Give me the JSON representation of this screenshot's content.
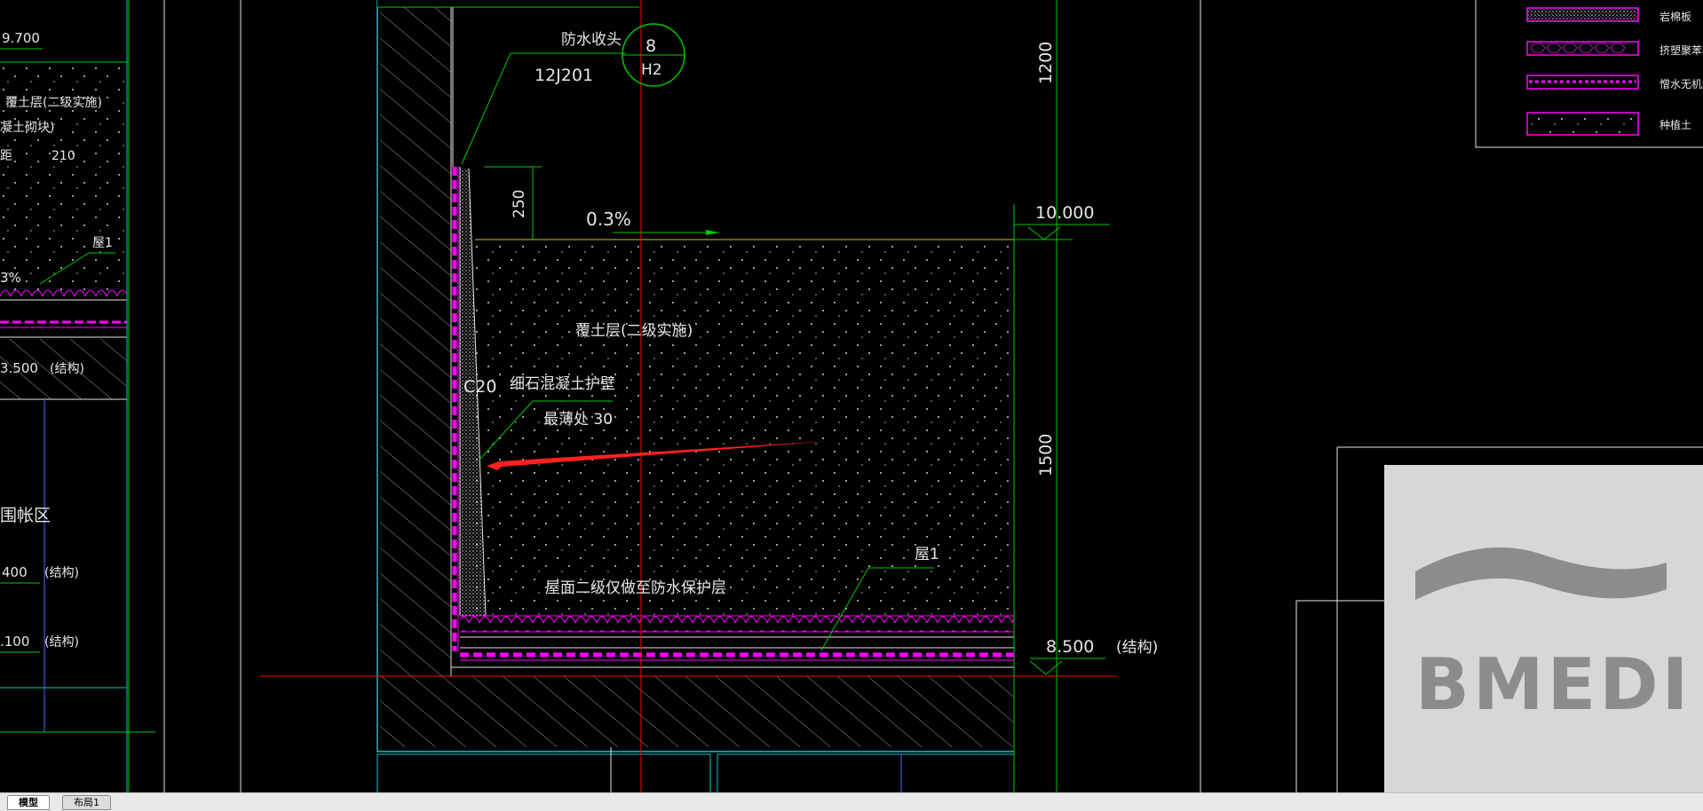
{
  "colors": {
    "background": "#000000",
    "green": "#00c800",
    "cyan": "#00c8c8",
    "magenta": "#ff00ff",
    "red": "#ff0000",
    "yellow": "#c8c800",
    "white": "#e6e6e6",
    "logo_bg": "#d7d7d7",
    "logo_fg": "#8c8c8c"
  },
  "left_detail": {
    "elev_top": "9.700",
    "soil_label": "覆土层(二级实施)",
    "concrete_label": "凝土砌块)",
    "spacing_label": "距",
    "spacing_value": "210",
    "roof_label": "屋1",
    "slope": "3%",
    "elev_struct": "3.500",
    "struct_label": "(结构)",
    "zone_label": "围帐区",
    "elev_2": "400",
    "struct_label_2": "(结构)",
    "elev_3": ".100",
    "struct_label_3": "(结构)"
  },
  "main_detail": {
    "waterproof_end": "防水收头",
    "spec_code": "12J201",
    "callout_num": "8",
    "callout_sheet": "H2",
    "dim_250": "250",
    "slope": "0.3%",
    "elev_top": "10.000",
    "dim_1200": "1200",
    "soil_label": "覆土层(二级实施)",
    "wall_grade": "C20",
    "wall_label": "细石混凝土护壁",
    "thinnest": "最薄处 30",
    "dim_1500": "1500",
    "roof_label": "屋1",
    "roof_note": "屋面二级仅做至防水保护层",
    "elev_bottom": "8.500",
    "struct_label": "(结构)"
  },
  "legend": {
    "items": [
      {
        "label": "岩棉板"
      },
      {
        "label": "挤塑聚苯板"
      },
      {
        "label": "憎水无机纤维"
      },
      {
        "label": "种植土"
      }
    ]
  },
  "logo": {
    "text": "BMEDI"
  },
  "tabs": [
    {
      "label": "模型",
      "active": true
    },
    {
      "label": "布局1",
      "active": false
    }
  ]
}
